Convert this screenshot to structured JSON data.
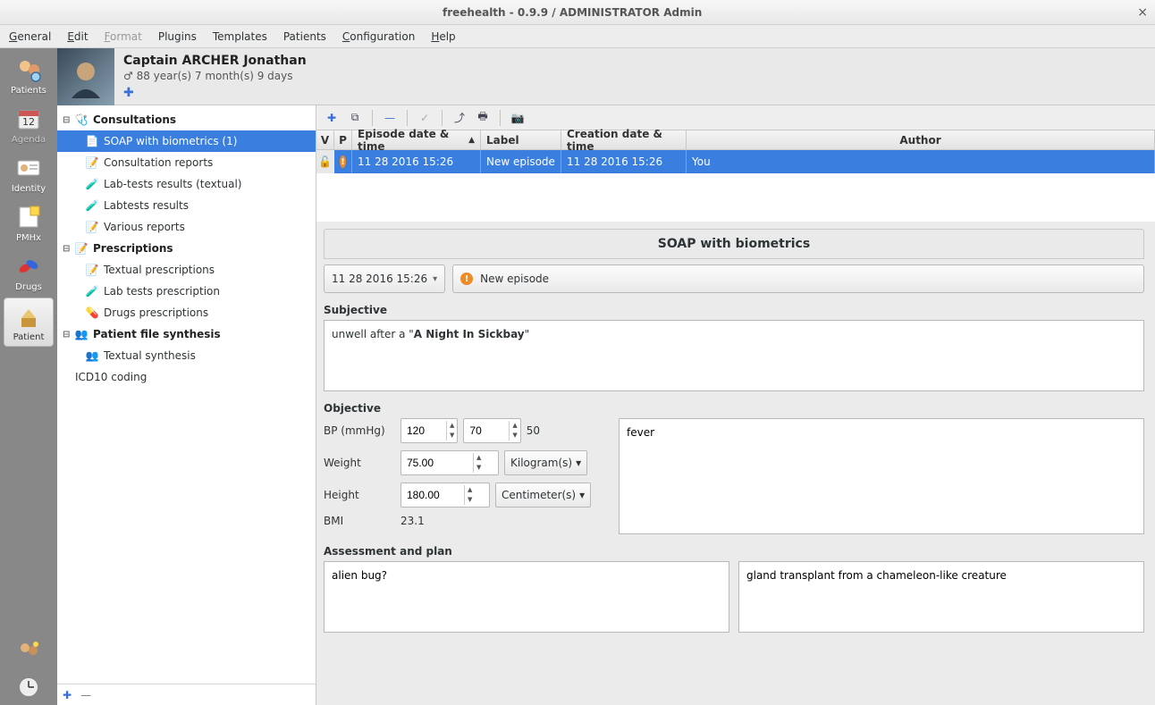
{
  "window": {
    "title": "freehealth - 0.9.9 /  ADMINISTRATOR Admin"
  },
  "menu": {
    "general": "General",
    "edit": "Edit",
    "format": "Format",
    "plugins": "Plugins",
    "templates": "Templates",
    "patients": "Patients",
    "configuration": "Configuration",
    "help": "Help"
  },
  "rail": {
    "patients": "Patients",
    "agenda": "Agenda",
    "identity": "Identity",
    "pmhx": "PMHx",
    "drugs": "Drugs",
    "patient": "Patient"
  },
  "patient": {
    "name": "Captain ARCHER Jonathan",
    "gender": "♂",
    "age": "88 year(s) 7 month(s) 9 days"
  },
  "tree": {
    "consultations": "Consultations",
    "soap": "SOAP with biometrics (1)",
    "reports": "Consultation reports",
    "labtext": "Lab-tests results (textual)",
    "labres": "Labtests results",
    "various": "Various reports",
    "prescriptions": "Prescriptions",
    "textpresc": "Textual prescriptions",
    "labpresc": "Lab tests prescription",
    "drugpresc": "Drugs prescriptions",
    "synthesis": "Patient file synthesis",
    "textsynth": "Textual synthesis",
    "icd10": "ICD10 coding"
  },
  "episodes": {
    "columns": {
      "v": "V",
      "p": "P",
      "date": "Episode date & time",
      "label": "Label",
      "creation": "Creation date & time",
      "author": "Author"
    },
    "rows": [
      {
        "date": "11 28 2016 15:26",
        "label": "New episode",
        "creation": "11 28 2016 15:26",
        "author": "You"
      }
    ]
  },
  "form": {
    "title": "SOAP with biometrics",
    "datetime": "11 28 2016 15:26",
    "episode_label": "New episode",
    "subjective_label": "Subjective",
    "subjective_text_prefix": "unwell after a \"",
    "subjective_text_bold": "A Night In Sickbay",
    "subjective_text_suffix": "\"",
    "objective_label": "Objective",
    "bp_label": "BP (mmHg)",
    "bp_sys": "120",
    "bp_dia": "70",
    "bp_pulse": "50",
    "obj_notes": "fever",
    "weight_label": "Weight",
    "weight_val": "75.00",
    "weight_unit": "Kilogram(s)",
    "height_label": "Height",
    "height_val": "180.00",
    "height_unit": "Centimeter(s)",
    "bmi_label": "BMI",
    "bmi_val": "23.1",
    "assessment_label": "Assessment and plan",
    "assessment_text": "alien bug?",
    "plan_text": "gland transplant from a chameleon-like creature"
  }
}
